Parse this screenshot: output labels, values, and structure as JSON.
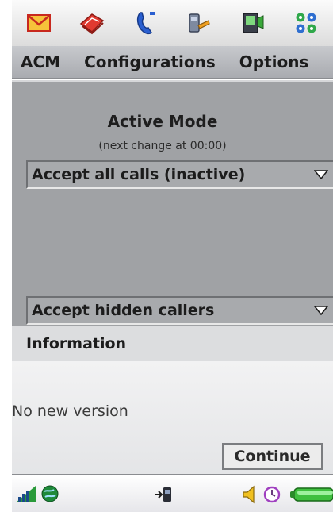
{
  "launcher": {
    "icons": [
      "messaging-icon",
      "contacts-icon",
      "phone-icon",
      "tools-icon",
      "media-icon",
      "apps-icon"
    ]
  },
  "menubar": {
    "items": [
      "ACM",
      "Configurations",
      "Options"
    ]
  },
  "main": {
    "title": "Active Mode",
    "subtitle": "(next change at 00:00)",
    "mode_select": {
      "value": "Accept all calls (inactive)"
    },
    "hidden_select": {
      "value": "Accept hidden callers"
    }
  },
  "info": {
    "header": "Information",
    "message": "No new version",
    "continue_label": "Continue"
  },
  "statusbar": {
    "icons": [
      "signal-icon",
      "network-icon",
      "connection-icon",
      "volume-icon",
      "clock-icon",
      "battery-icon"
    ]
  },
  "colors": {
    "main_bg": "#a0a2a5",
    "menubar_bg": "#b8babe",
    "info_header_bg": "#dcdddf",
    "accent_green": "#3aa83a"
  }
}
